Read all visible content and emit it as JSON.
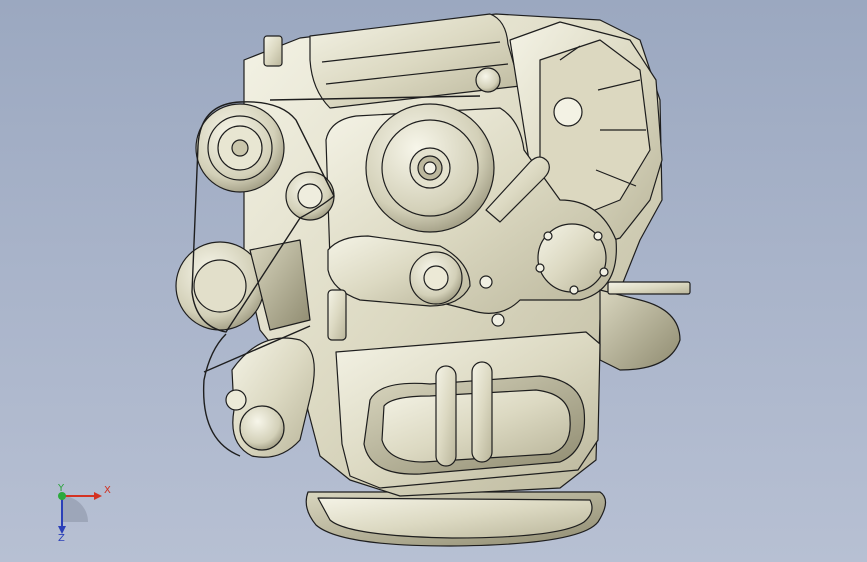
{
  "triad": {
    "x_label": "X",
    "y_label": "Y",
    "z_label": "Z",
    "x_color": "#d43222",
    "y_color": "#2ca93c",
    "z_color": "#2a3fb8"
  },
  "model": {
    "subject": "engine-assembly",
    "surface_color": "#e6e4d2",
    "edge_color": "#1e1e1e",
    "background_top": "#9ba8c0",
    "background_bottom": "#b7c0d3"
  }
}
